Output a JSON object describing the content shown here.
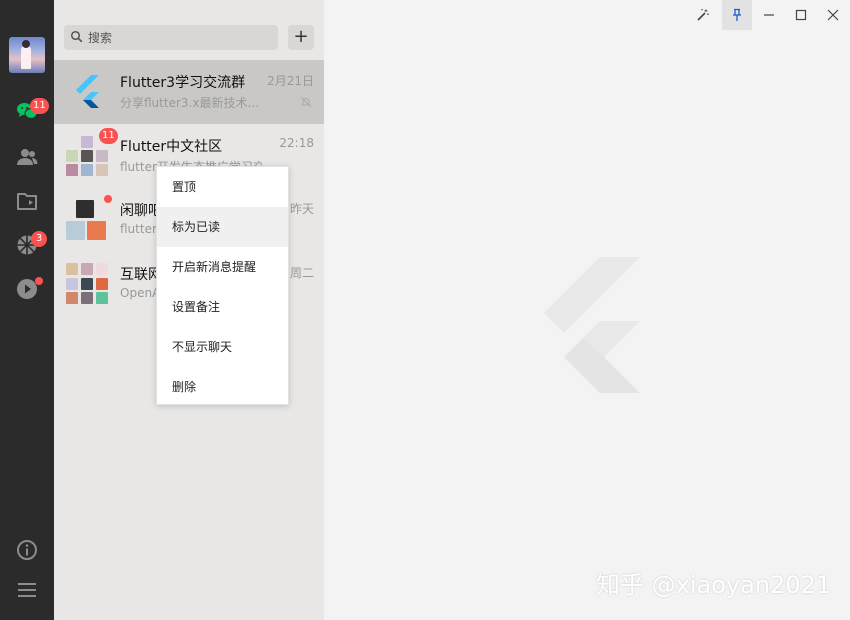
{
  "sidebar": {
    "items": [
      {
        "icon": "chat-icon",
        "badge": "11"
      },
      {
        "icon": "contacts-icon"
      },
      {
        "icon": "folder-icon"
      },
      {
        "icon": "moments-icon",
        "badge": "3"
      },
      {
        "icon": "video-icon",
        "dot": true
      }
    ],
    "bottom": [
      {
        "icon": "info-icon"
      },
      {
        "icon": "menu-icon"
      }
    ]
  },
  "search": {
    "placeholder": "搜索",
    "add_label": "+"
  },
  "chats": [
    {
      "name": "Flutter3学习交流群",
      "time": "2月21日",
      "preview": "分享flutter3.x最新技术...",
      "muted": true
    },
    {
      "name": "Flutter中文社区",
      "time": "22:18",
      "preview": "flutter开发生态推广学习交...",
      "badge": "11"
    },
    {
      "name": "闲聊吧",
      "time": "昨天",
      "preview": "flutter",
      "dot": true
    },
    {
      "name": "互联网",
      "time": "周二",
      "preview": "OpenAI"
    }
  ],
  "context_menu": {
    "items": [
      "置顶",
      "标为已读",
      "开启新消息提醒",
      "设置备注",
      "不显示聊天",
      "删除"
    ],
    "hovered_index": 1
  },
  "window": {
    "controls": [
      "wand-icon",
      "pin-icon",
      "minimize-icon",
      "maximize-icon",
      "close-icon"
    ]
  },
  "watermark": "知乎 @xiaoyan2021",
  "colors": {
    "rail": "#2b2b2b",
    "list_bg": "#e9e7e5",
    "active_row": "#c9c8c6",
    "badge": "#fa5151",
    "chat_icon": "#07c160"
  }
}
